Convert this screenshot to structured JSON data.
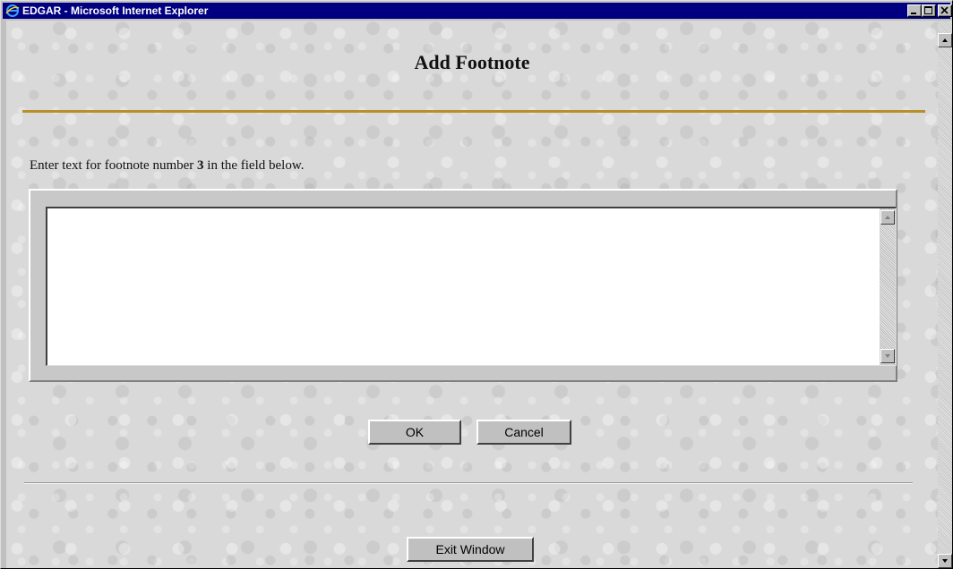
{
  "window": {
    "title": "EDGAR - Microsoft Internet Explorer"
  },
  "page": {
    "heading": "Add Footnote",
    "instruction_prefix": "Enter text for footnote number ",
    "footnote_number": "3",
    "instruction_suffix": " in the field below.",
    "footnote_text": ""
  },
  "buttons": {
    "ok": "OK",
    "cancel": "Cancel",
    "exit": "Exit Window"
  },
  "colors": {
    "titlebar": "#000080",
    "rule": "#b8902a"
  },
  "icons": {
    "app": "ie-icon",
    "minimize": "minimize-icon",
    "maximize": "maximize-icon",
    "close": "close-icon"
  }
}
